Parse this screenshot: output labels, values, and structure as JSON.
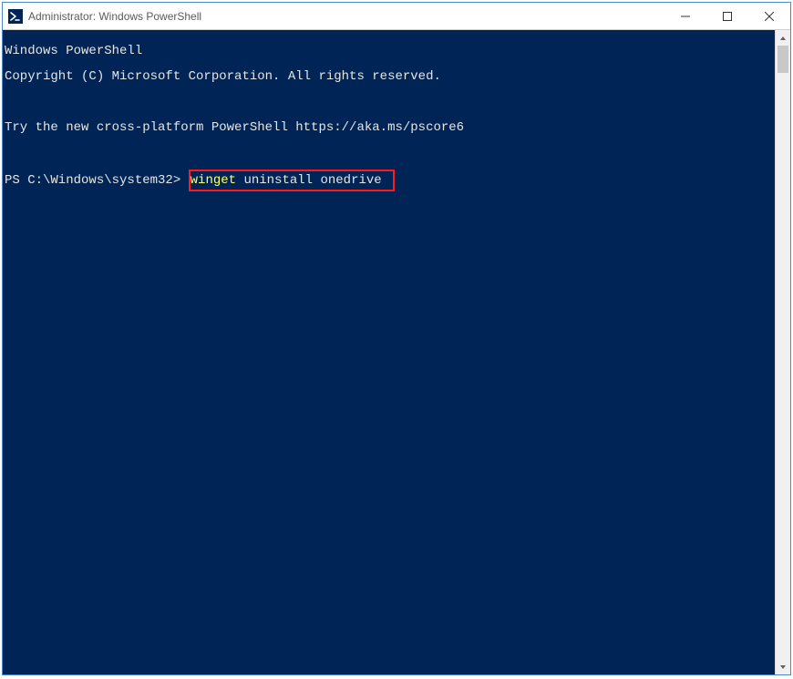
{
  "window": {
    "title": "Administrator: Windows PowerShell"
  },
  "terminal": {
    "line1": "Windows PowerShell",
    "line2": "Copyright (C) Microsoft Corporation. All rights reserved.",
    "line3": "",
    "line4": "Try the new cross-platform PowerShell https://aka.ms/pscore6",
    "line5": "",
    "prompt": "PS C:\\Windows\\system32> ",
    "cmd_kw": "winget",
    "cmd_rest": " uninstall onedrive"
  }
}
